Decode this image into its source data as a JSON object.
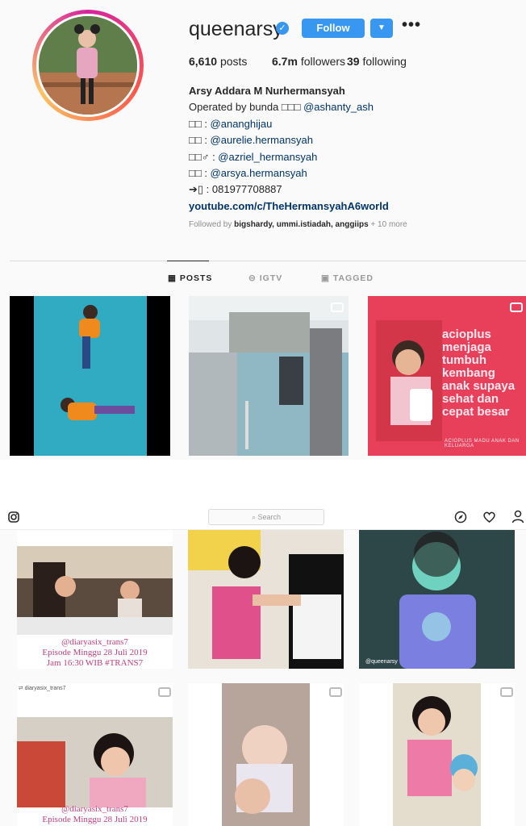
{
  "profile": {
    "username": "queenarsy",
    "follow_label": "Follow",
    "more_label": "•••",
    "verified_glyph": "✓",
    "stats": {
      "posts_count": "6,610",
      "posts_label": "posts",
      "followers_count": "6.7m",
      "followers_label": "followers",
      "following_count": "39",
      "following_label": "following"
    },
    "bio": {
      "full_name": "Arsy Addara M Nurhermansyah",
      "line1_prefix": "Operated by bunda □□□ ",
      "line1_mention": "@ashanty_ash",
      "line2_prefix": "□□ : ",
      "line2_mention": "@ananghijau",
      "line3_prefix": "□□ : ",
      "line3_mention": "@aurelie.hermansyah",
      "line4_prefix": "□□♂ : ",
      "line4_mention": "@azriel_hermansyah",
      "line5_prefix": "□□ : ",
      "line5_mention": "@arsya.hermansyah",
      "phone": "➔▯ : 081977708887",
      "website": "youtube.com/c/TheHermansyahA6world"
    },
    "followed_by": {
      "prefix": "Followed by ",
      "names": "bigshardy, ummi.istiadah, anggiips",
      "suffix": " + 10 more"
    }
  },
  "tabs": {
    "posts": "POSTS",
    "igtv": "IGTV",
    "tagged": "TAGGED"
  },
  "posts_top": {
    "tile3_text": "acioplus menjaga tumbuh kembang anak supaya sehat dan cepat besar",
    "tile3_footer": "ACIOPLUS MADU ANAK DAN KELUARGA"
  },
  "navbar": {
    "search_placeholder": "Search"
  },
  "posts_bottom": {
    "caption1_l1": "@diaryasix_trans7",
    "caption1_l2": "Episode Minggu 28 Juli 2019",
    "caption1_l3": "Jam 16:30 WIB #TRANS7",
    "watermark": "@queenarsy",
    "repost_user": "diaryasix_trans7",
    "caption2_l1": "@diaryasix_trans7",
    "caption2_l2": "Episode Minggu 28 Juli 2019"
  },
  "colors": {
    "accent_blue": "#3897f0",
    "link": "#003569",
    "caption_pink": "#c0417e",
    "ad_red": "#e8405a"
  }
}
